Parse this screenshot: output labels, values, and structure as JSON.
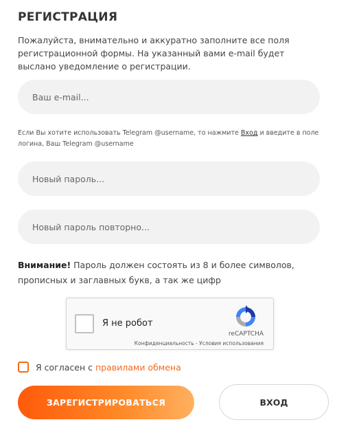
{
  "form": {
    "title": "РЕГИСТРАЦИЯ",
    "intro": "Пожалуйста, внимательно и аккуратно заполните все поля регистрационной формы. На указанный вами e-mail будет выслано уведомление о регистрации.",
    "email_placeholder": "Ваш e-mail...",
    "hint_before": "Если Вы хотите использовать Telegram @username, то нажмите ",
    "hint_link": "Вход",
    "hint_after": " и введите в поле логина, Ваш Telegram @username",
    "password_placeholder": "Новый пароль...",
    "password_repeat_placeholder": "Новый пароль повторно...",
    "warning_bold": "Внимание!",
    "warning_text": " Пароль должен состоять из 8 и более символов, прописных и заглавных букв, а так же цифр",
    "agree_text": "Я согласен с",
    "agree_link": "правилами обмена",
    "register_label": "ЗАРЕГИСТРИРОВАТЬСЯ",
    "login_label": "ВХОД"
  },
  "recaptcha": {
    "label": "Я не робот",
    "brand": "reCAPTCHA",
    "links": "Конфиденциальность - Условия использования",
    "icon": "recaptcha-logo"
  },
  "colors": {
    "accent": "#f26a1b",
    "button_gradient_start": "#ff5a0a",
    "button_gradient_end": "#ffb060",
    "field_bg": "#f2f2f2"
  }
}
